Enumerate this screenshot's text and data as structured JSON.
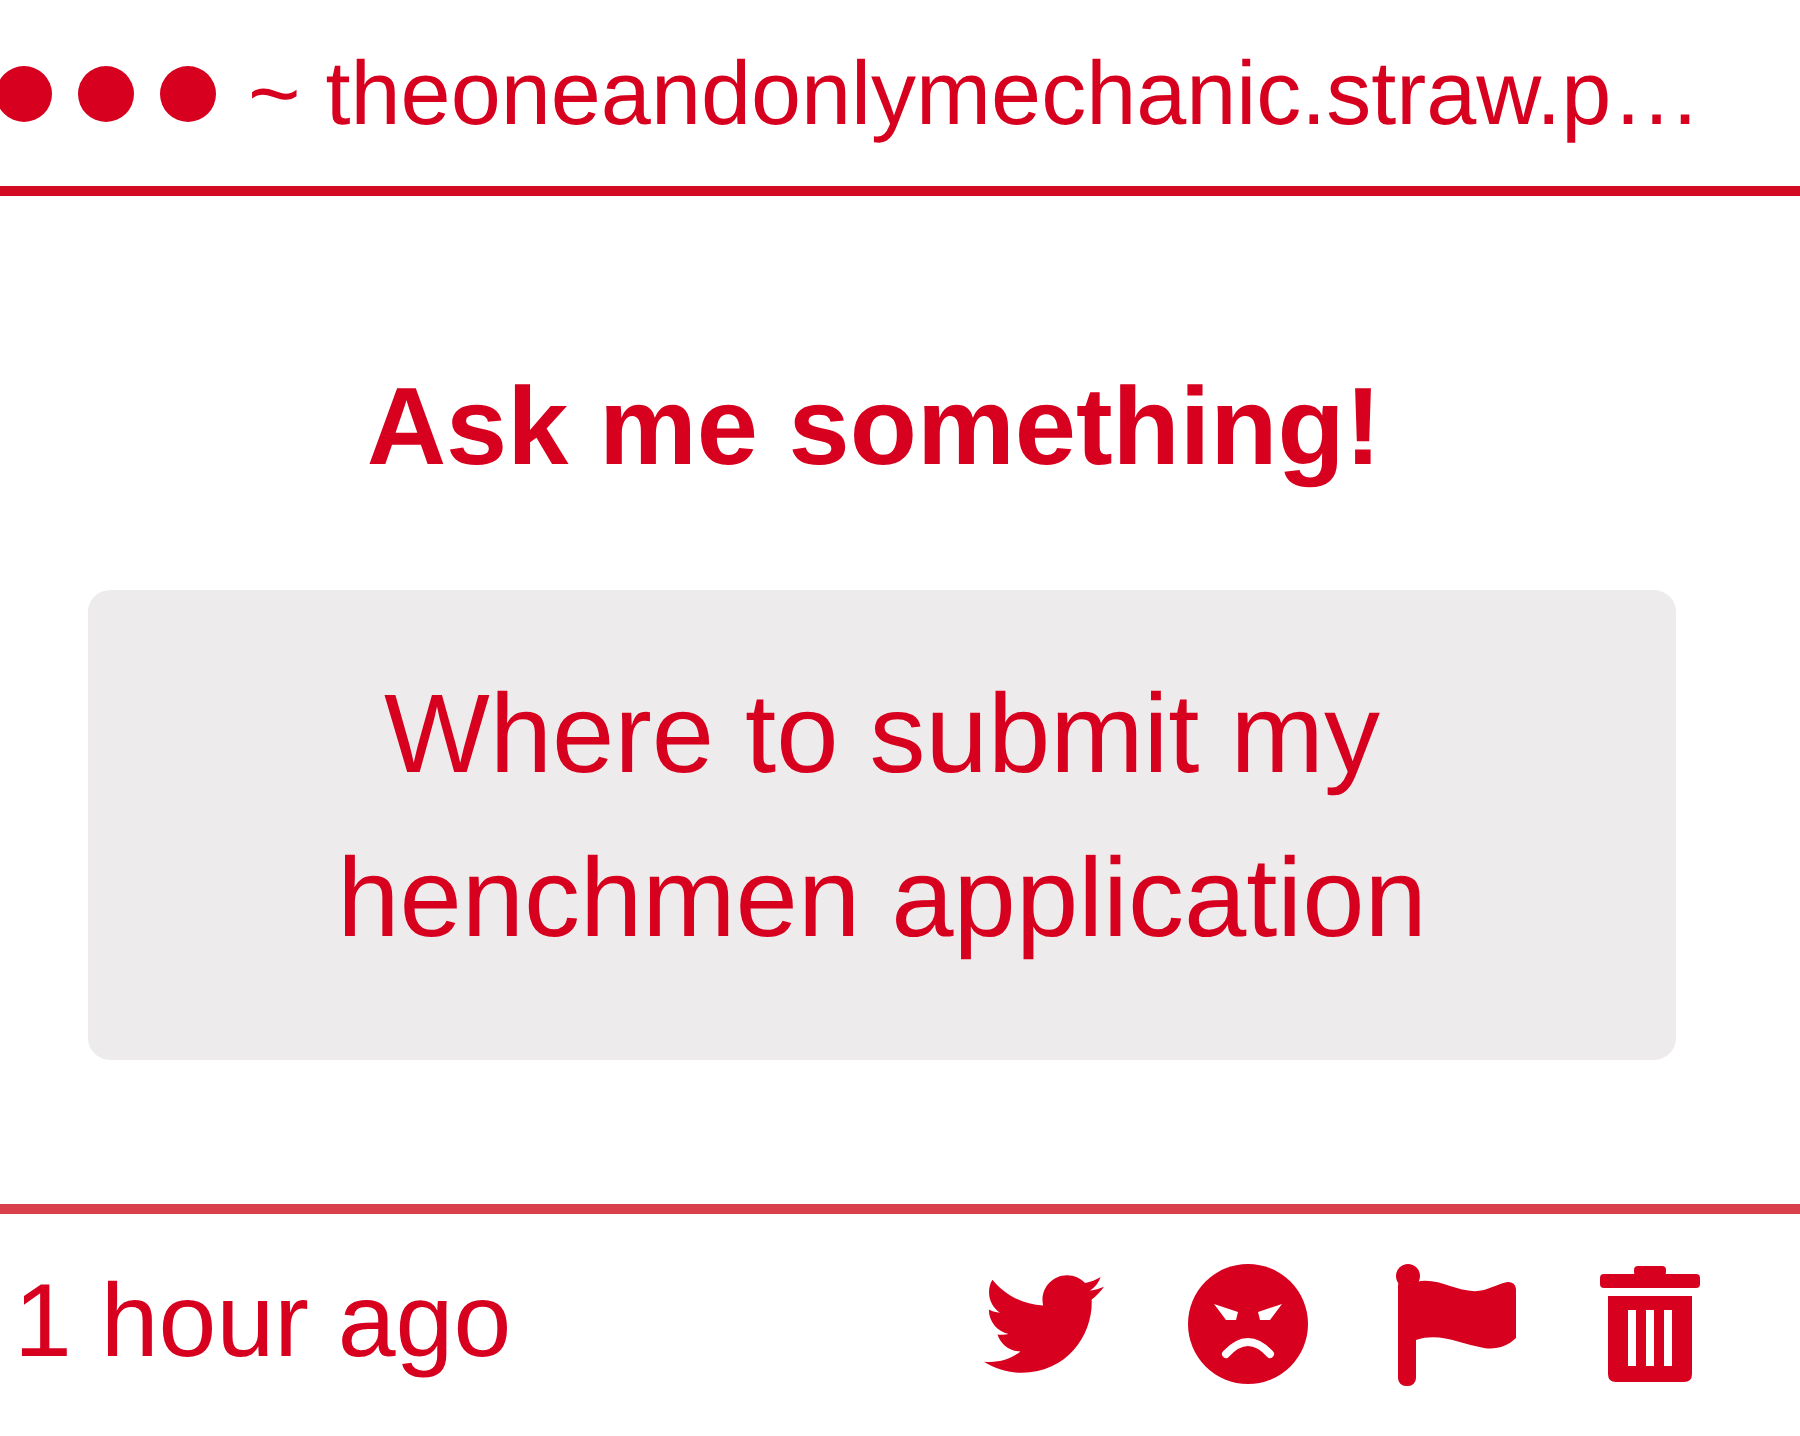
{
  "header": {
    "url": "~ theoneandonlymechanic.straw.p…"
  },
  "title": "Ask me something!",
  "question": "Where to submit my henchmen application",
  "footer": {
    "time": "1 hour ago"
  }
}
